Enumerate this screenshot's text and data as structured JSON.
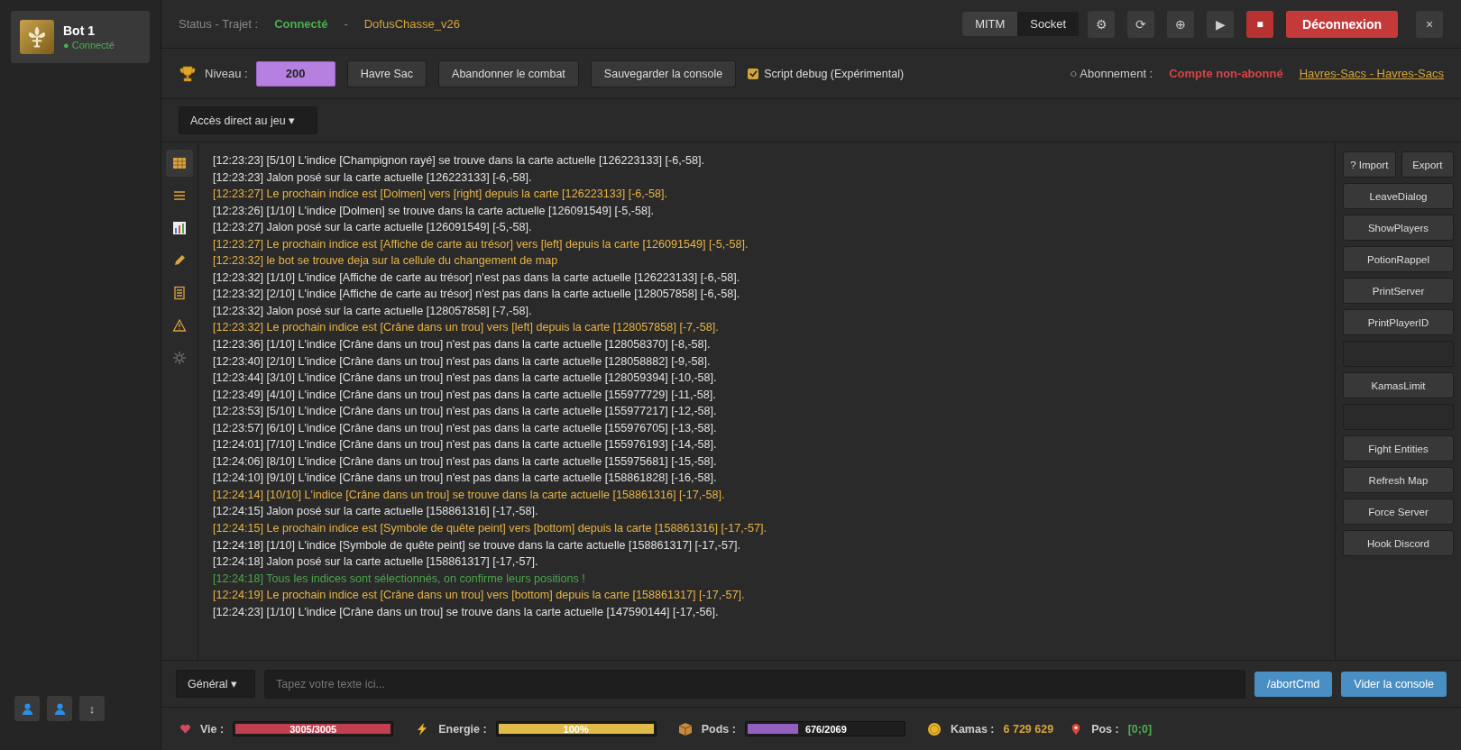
{
  "sidebar": {
    "bots": [
      {
        "name": "Bot 1",
        "status": "● Connecté",
        "selected": true
      }
    ],
    "footer_buttons": [
      {
        "kind": "user"
      },
      {
        "kind": "user"
      },
      {
        "kind": "text",
        "label": "↕"
      }
    ]
  },
  "header": {
    "status_label": "Status - Trajet :",
    "status": "Connecté",
    "separator": "-",
    "script": "DofusChasse_v26",
    "mode_tabs": [
      {
        "label": "MITM",
        "selected": true
      },
      {
        "label": "Socket",
        "selected": false
      }
    ],
    "icon_buttons": [
      {
        "label": "⚙",
        "kind": "plain"
      },
      {
        "label": "⟳",
        "kind": "plain"
      },
      {
        "label": "⊕",
        "kind": "plain"
      },
      {
        "label": "▶",
        "kind": "plain"
      },
      {
        "label": "■",
        "kind": "danger"
      }
    ],
    "disconnect": "Déconnexion",
    "close": "×"
  },
  "toolbar": {
    "level_label": "Niveau :",
    "level": "200",
    "buttons": [
      "Havre Sac",
      "Abandonner le combat",
      "Sauvegarder la console"
    ],
    "debug": {
      "label": "Script debug (Expérimental)",
      "checked": true
    },
    "subscription_label": "○ Abonnement :",
    "subscription": "Compte non-abonné",
    "link": "Havres-Sacs - Havres-Sacs"
  },
  "game_access": "Accès direct au jeu ▾",
  "nav": [
    {
      "kind": "grid",
      "selected": true
    },
    {
      "kind": "list",
      "selected": false
    },
    {
      "kind": "chart",
      "selected": false
    },
    {
      "kind": "pencil",
      "selected": false
    },
    {
      "kind": "document",
      "selected": false
    },
    {
      "kind": "warning",
      "selected": false
    },
    {
      "kind": "gear",
      "selected": false
    }
  ],
  "log": [
    {
      "kind": "info",
      "text": "[12:23:23] [5/10] L'indice [Champignon rayé] se trouve dans la carte actuelle [126223133] [-6,-58]."
    },
    {
      "kind": "info",
      "text": "[12:23:23] Jalon posé sur la carte actuelle [126223133] [-6,-58]."
    },
    {
      "kind": "hint",
      "text": "[12:23:27] Le prochain indice est [Dolmen] vers [right] depuis la carte [126223133] [-6,-58]."
    },
    {
      "kind": "info",
      "text": "[12:23:26] [1/10] L'indice [Dolmen] se trouve dans la carte actuelle [126091549] [-5,-58]."
    },
    {
      "kind": "info",
      "text": "[12:23:27] Jalon posé sur la carte actuelle [126091549] [-5,-58]."
    },
    {
      "kind": "hint",
      "text": "[12:23:27] Le prochain indice est [Affiche de carte au trésor] vers [left] depuis la carte [126091549] [-5,-58]."
    },
    {
      "kind": "hint",
      "text": "[12:23:32] le bot se trouve deja sur la cellule du changement de map"
    },
    {
      "kind": "info",
      "text": "[12:23:32] [1/10] L'indice [Affiche de carte au trésor] n'est pas dans la carte actuelle [126223133] [-6,-58]."
    },
    {
      "kind": "info",
      "text": "[12:23:32] [2/10] L'indice [Affiche de carte au trésor] n'est pas dans la carte actuelle [128057858] [-6,-58]."
    },
    {
      "kind": "info",
      "text": "[12:23:32] Jalon posé sur la carte actuelle [128057858] [-7,-58]."
    },
    {
      "kind": "hint",
      "text": "[12:23:32] Le prochain indice est [Crâne dans un trou] vers [left] depuis la carte [128057858] [-7,-58]."
    },
    {
      "kind": "info",
      "text": "[12:23:36] [1/10] L'indice [Crâne dans un trou] n'est pas dans la carte actuelle [128058370] [-8,-58]."
    },
    {
      "kind": "info",
      "text": "[12:23:40] [2/10] L'indice [Crâne dans un trou] n'est pas dans la carte actuelle [128058882] [-9,-58]."
    },
    {
      "kind": "info",
      "text": "[12:23:44] [3/10] L'indice [Crâne dans un trou] n'est pas dans la carte actuelle [128059394] [-10,-58]."
    },
    {
      "kind": "info",
      "text": "[12:23:49] [4/10] L'indice [Crâne dans un trou] n'est pas dans la carte actuelle [155977729] [-11,-58]."
    },
    {
      "kind": "info",
      "text": "[12:23:53] [5/10] L'indice [Crâne dans un trou] n'est pas dans la carte actuelle [155977217] [-12,-58]."
    },
    {
      "kind": "info",
      "text": "[12:23:57] [6/10] L'indice [Crâne dans un trou] n'est pas dans la carte actuelle [155976705] [-13,-58]."
    },
    {
      "kind": "info",
      "text": "[12:24:01] [7/10] L'indice [Crâne dans un trou] n'est pas dans la carte actuelle [155976193] [-14,-58]."
    },
    {
      "kind": "info",
      "text": "[12:24:06] [8/10] L'indice [Crâne dans un trou] n'est pas dans la carte actuelle [155975681] [-15,-58]."
    },
    {
      "kind": "info",
      "text": "[12:24:10] [9/10] L'indice [Crâne dans un trou] n'est pas dans la carte actuelle [158861828] [-16,-58]."
    },
    {
      "kind": "hint",
      "text": "[12:24:14] [10/10] L'indice [Crâne dans un trou] se trouve dans la carte actuelle [158861316] [-17,-58]."
    },
    {
      "kind": "info",
      "text": "[12:24:15] Jalon posé sur la carte actuelle [158861316] [-17,-58]."
    },
    {
      "kind": "hint",
      "text": "[12:24:15] Le prochain indice est [Symbole de quête peint] vers [bottom] depuis la carte [158861316] [-17,-57]."
    },
    {
      "kind": "info",
      "text": "[12:24:18] [1/10] L'indice [Symbole de quête peint] se trouve dans la carte actuelle [158861317] [-17,-57]."
    },
    {
      "kind": "info",
      "text": "[12:24:18] Jalon posé sur la carte actuelle [158861317] [-17,-57]."
    },
    {
      "kind": "success",
      "text": "[12:24:18] Tous les indices sont sélectionnés, on confirme leurs positions !"
    },
    {
      "kind": "hint",
      "text": "[12:24:19] Le prochain indice est [Crâne dans un trou] vers [bottom] depuis la carte [158861317] [-17,-57]."
    },
    {
      "kind": "info",
      "text": "[12:24:23] [1/10] L'indice [Crâne dans un trou] se trouve dans la carte actuelle [147590144] [-17,-56]."
    }
  ],
  "actions": {
    "pair": [
      "? Import",
      "Export"
    ],
    "buttons": [
      {
        "kind": "command",
        "label": "LeaveDialog"
      },
      {
        "kind": "command",
        "label": "ShowPlayers"
      },
      {
        "kind": "command",
        "label": "PotionRappel"
      },
      {
        "kind": "command",
        "label": "PrintServer"
      },
      {
        "kind": "command",
        "label": "PrintPlayerID"
      },
      {
        "kind": "blank"
      },
      {
        "kind": "command",
        "label": "KamasLimit"
      },
      {
        "kind": "blank"
      },
      {
        "kind": "command",
        "label": "Fight Entities"
      },
      {
        "kind": "command",
        "label": "Refresh Map"
      },
      {
        "kind": "command",
        "label": "Force Server"
      },
      {
        "kind": "command",
        "label": "Hook Discord"
      }
    ]
  },
  "console": {
    "channel": "Général ▾",
    "placeholder": "Tapez votre texte ici...",
    "buttons": [
      "/abortCmd",
      "Vider la console"
    ]
  },
  "status_bar": {
    "bars": [
      {
        "kind": "life",
        "label": "Vie :",
        "reading": "3005/3005",
        "level": 1.0
      },
      {
        "kind": "energy",
        "label": "Energie :",
        "reading": "100%",
        "level": 1.0
      },
      {
        "kind": "pods",
        "label": "Pods :",
        "reading": "676/2069",
        "level": 0.327
      }
    ],
    "kamas_label": "Kamas :",
    "kamas": "6 729 629",
    "pos_label": "Pos :",
    "pos": "[0;0]"
  }
}
